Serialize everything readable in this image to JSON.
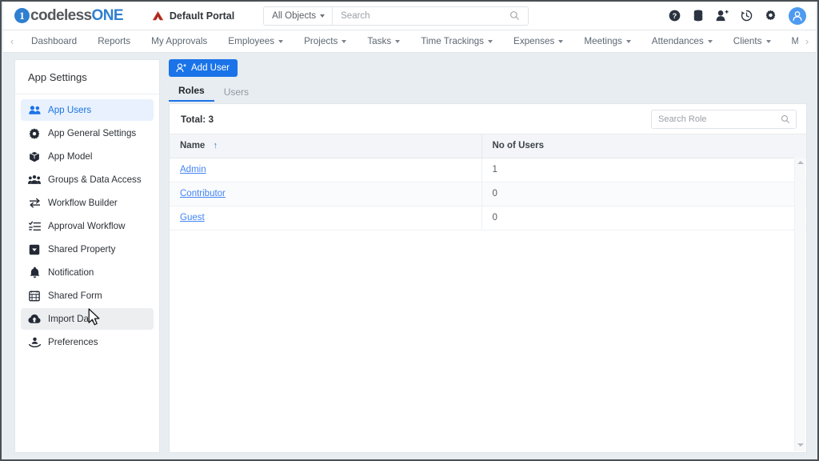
{
  "header": {
    "logo_prefix": "codeless",
    "logo_suffix": "ONE",
    "logo_mark": "1",
    "portal_name": "Default Portal",
    "portal_icon": "portal-logo-icon",
    "object_scope": "All Objects",
    "search_placeholder": "Search",
    "search_value": "",
    "icons": [
      {
        "name": "help-icon",
        "glyph": "?"
      },
      {
        "name": "database-icon",
        "glyph": ""
      },
      {
        "name": "add-user-icon",
        "glyph": ""
      },
      {
        "name": "history-icon",
        "glyph": ""
      },
      {
        "name": "settings-gear-icon",
        "glyph": ""
      },
      {
        "name": "user-avatar",
        "glyph": ""
      }
    ]
  },
  "nav": {
    "prev_arrow": "‹",
    "next_arrow": "›",
    "items": [
      {
        "label": "Dashboard",
        "dropdown": false
      },
      {
        "label": "Reports",
        "dropdown": false
      },
      {
        "label": "My Approvals",
        "dropdown": false
      },
      {
        "label": "Employees",
        "dropdown": true
      },
      {
        "label": "Projects",
        "dropdown": true
      },
      {
        "label": "Tasks",
        "dropdown": true
      },
      {
        "label": "Time Trackings",
        "dropdown": true
      },
      {
        "label": "Expenses",
        "dropdown": true
      },
      {
        "label": "Meetings",
        "dropdown": true
      },
      {
        "label": "Attendances",
        "dropdown": true
      },
      {
        "label": "Clients",
        "dropdown": true
      },
      {
        "label": "Milestones",
        "dropdown": true
      }
    ]
  },
  "sidebar": {
    "title": "App Settings",
    "items": [
      {
        "label": "App Users",
        "icon": "users-group-icon",
        "state": "active"
      },
      {
        "label": "App General Settings",
        "icon": "gear-icon",
        "state": "normal"
      },
      {
        "label": "App Model",
        "icon": "cube-icon",
        "state": "normal"
      },
      {
        "label": "Groups & Data Access",
        "icon": "people-group-icon",
        "state": "normal"
      },
      {
        "label": "Workflow Builder",
        "icon": "arrows-exchange-icon",
        "state": "normal"
      },
      {
        "label": "Approval Workflow",
        "icon": "checklist-icon",
        "state": "normal"
      },
      {
        "label": "Shared Property",
        "icon": "dropdown-box-icon",
        "state": "normal"
      },
      {
        "label": "Notification",
        "icon": "bell-icon",
        "state": "normal"
      },
      {
        "label": "Shared Form",
        "icon": "form-icon",
        "state": "normal"
      },
      {
        "label": "Import Data",
        "icon": "cloud-upload-icon",
        "state": "hover"
      },
      {
        "label": "Preferences",
        "icon": "hand-person-icon",
        "state": "normal"
      }
    ]
  },
  "main": {
    "add_user_button": "Add User",
    "add_user_icon": "person-plus-icon",
    "tabs": [
      {
        "label": "Roles",
        "active": true
      },
      {
        "label": "Users",
        "active": false
      }
    ],
    "total_label": "Total: 3",
    "role_search_placeholder": "Search Role",
    "role_search_value": "",
    "table": {
      "columns": [
        {
          "label": "Name",
          "sort": "ascending"
        },
        {
          "label": "No of Users",
          "sort": "none"
        }
      ],
      "rows": [
        {
          "name": "Admin",
          "users": "1"
        },
        {
          "name": "Contributor",
          "users": "0"
        },
        {
          "name": "Guest",
          "users": "0"
        }
      ]
    }
  },
  "colors": {
    "accent_blue": "#1a73e8",
    "link_blue": "#4285f4",
    "active_bg": "#e8f1fd",
    "page_bg": "#e7edf1",
    "logo_blue": "#2f7fd1"
  }
}
